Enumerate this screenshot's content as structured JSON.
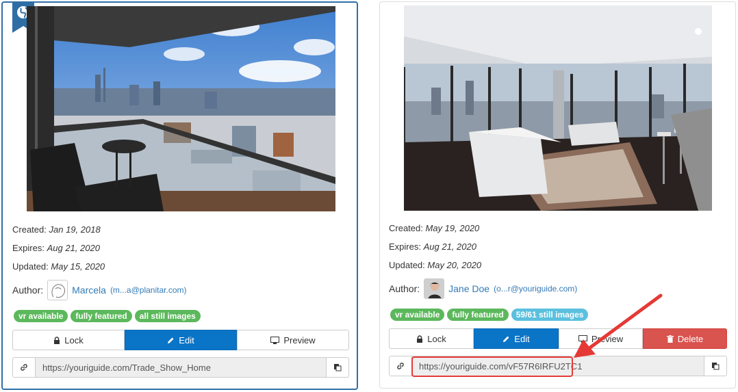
{
  "cards": [
    {
      "created_label": "Created:",
      "created_value": "Jan 19, 2018",
      "expires_label": "Expires:",
      "expires_value": "Aug 21, 2020",
      "updated_label": "Updated:",
      "updated_value": "May 15, 2020",
      "author_label": "Author:",
      "author_name": "Marcela",
      "author_email": "(m...a@planitar.com)",
      "badges": [
        "vr available",
        "fully featured",
        "all still images"
      ],
      "buttons": {
        "lock": "Lock",
        "edit": "Edit",
        "preview": "Preview"
      },
      "url": "https://youriguide.com/Trade_Show_Home"
    },
    {
      "created_label": "Created:",
      "created_value": "May 19, 2020",
      "expires_label": "Expires:",
      "expires_value": "Aug 21, 2020",
      "updated_label": "Updated:",
      "updated_value": "May 20, 2020",
      "author_label": "Author:",
      "author_name": "Jane Doe",
      "author_email": "(o...r@youriguide.com)",
      "badges": [
        "vr available",
        "fully featured",
        "59/61 still images"
      ],
      "buttons": {
        "lock": "Lock",
        "edit": "Edit",
        "preview": "Preview",
        "delete": "Delete"
      },
      "url": "https://youriguide.com/vF57R6IRFU2TC1"
    }
  ],
  "icons": [
    "globe-icon",
    "lock-icon",
    "pencil-icon",
    "monitor-icon",
    "trash-icon",
    "link-icon",
    "copy-icon",
    "annotation-arrow"
  ],
  "colors": {
    "primary": "#0a74c7",
    "success": "#5cb85c",
    "info": "#5bc0de",
    "danger": "#d9534f",
    "annotation": "#e53935",
    "active_border": "#2f6ea5"
  }
}
